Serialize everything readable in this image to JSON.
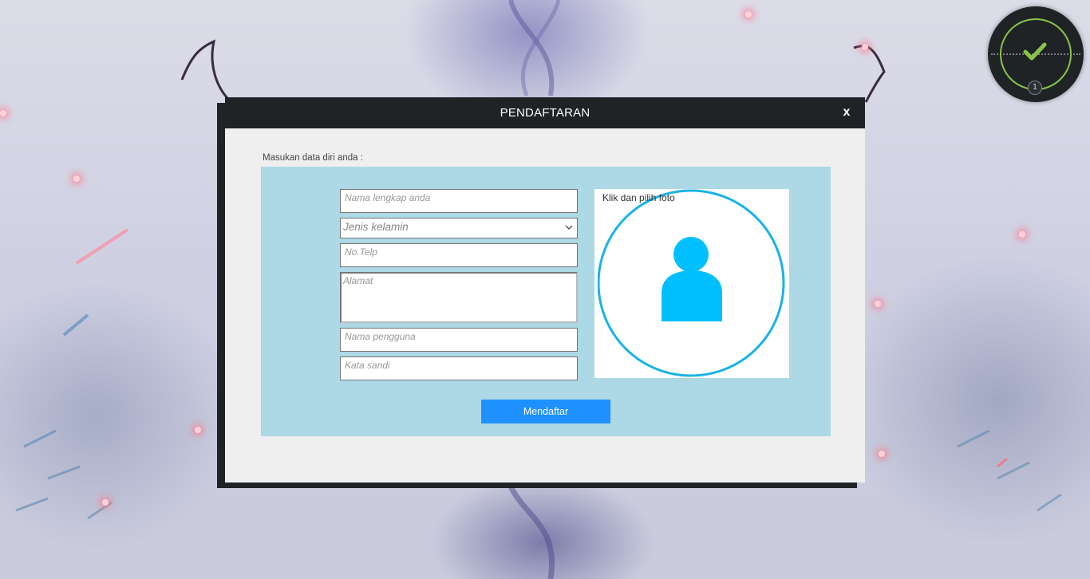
{
  "dialog": {
    "title": "PENDAFTARAN",
    "close_label": "x",
    "instruction": "Masukan data diri anda :"
  },
  "form": {
    "fullname": {
      "placeholder": "Nama lengkap anda",
      "value": ""
    },
    "gender": {
      "placeholder": "Jenis kelamin",
      "value": ""
    },
    "phone": {
      "placeholder": "No.Telp",
      "value": ""
    },
    "address": {
      "placeholder": "Alamat",
      "value": ""
    },
    "username": {
      "placeholder": "Nama pengguna",
      "value": ""
    },
    "password": {
      "placeholder": "Kata sandi",
      "value": ""
    },
    "submit_label": "Mendaftar"
  },
  "photo": {
    "label": "Klik dan pilih foto",
    "icon": "user-avatar-icon"
  },
  "status_widget": {
    "count": "1",
    "icon": "check-icon"
  },
  "colors": {
    "header_bg": "#1f2326",
    "dialog_bg": "#efefef",
    "panel_bg": "#add8e6",
    "accent": "#1e90ff",
    "avatar": "#00bfff",
    "status_ring": "#8bc34a"
  }
}
